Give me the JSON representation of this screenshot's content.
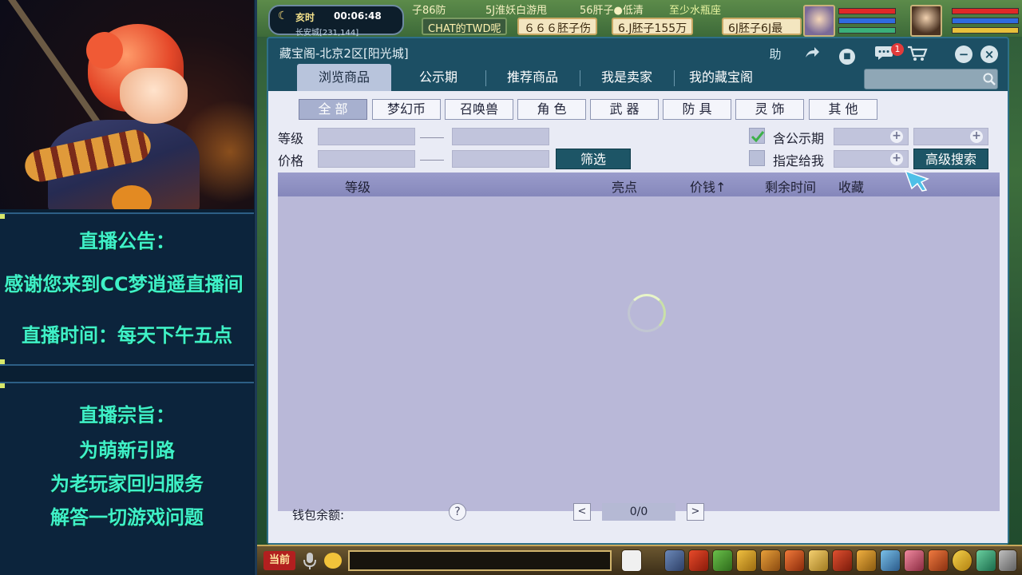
{
  "stream": {
    "notice_title": "直播公告：",
    "notice_welcome": "感谢您来到CC梦逍遥直播间",
    "notice_time": "直播时间：每天下午五点",
    "purpose_title": "直播宗旨：",
    "purpose_1": "为萌新引路",
    "purpose_2": "为老玩家回归服务",
    "purpose_3": "解答一切游戏问题"
  },
  "hud": {
    "time_label": "亥时",
    "clock": "00:06:48",
    "location": "长安城[231,144]",
    "scroll_1": "子86防",
    "scroll_2": "5J淮妖白游甩",
    "scroll_3": "56肝子●低清",
    "scroll_4": "至少水瓶座",
    "sign_1": "CHAT的TWD呢",
    "sign_2": "６６６胚子伤",
    "sign_3": "6.J胚子155万",
    "sign_4": "6J胚子6J最",
    "colors": {
      "hp": "#e02828",
      "mp": "#2f6be0"
    }
  },
  "dialog": {
    "title": "藏宝阁-北京2区[阳光城]",
    "help_label": "助",
    "chat_badge": "1",
    "tabs": [
      {
        "label": "浏览商品",
        "active": true
      },
      {
        "label": "公示期",
        "active": false
      },
      {
        "label": "推荐商品",
        "active": false
      },
      {
        "label": "我是卖家",
        "active": false
      },
      {
        "label": "我的藏宝阁",
        "active": false
      }
    ],
    "categories": [
      {
        "label": "全 部",
        "active": true
      },
      {
        "label": "梦幻币",
        "active": false
      },
      {
        "label": "召唤兽",
        "active": false
      },
      {
        "label": "角 色",
        "active": false
      },
      {
        "label": "武 器",
        "active": false
      },
      {
        "label": "防 具",
        "active": false
      },
      {
        "label": "灵 饰",
        "active": false
      },
      {
        "label": "其 他",
        "active": false
      }
    ],
    "filters": {
      "level_label": "等级",
      "price_label": "价格",
      "filter_button": "筛选",
      "include_public_label": "含公示期",
      "include_public_checked": true,
      "assigned_to_me_label": "指定给我",
      "assigned_to_me_checked": false,
      "advanced_search": "高级搜索"
    },
    "table": {
      "columns": [
        "等级",
        "亮点",
        "价钱",
        "剩余时间",
        "收藏"
      ],
      "sort_arrow": "↑"
    },
    "footer": {
      "wallet_label": "钱包余额:",
      "help": "?",
      "prev": "<",
      "next": ">",
      "page": "0/0"
    }
  },
  "bottom": {
    "channel": "当前"
  }
}
